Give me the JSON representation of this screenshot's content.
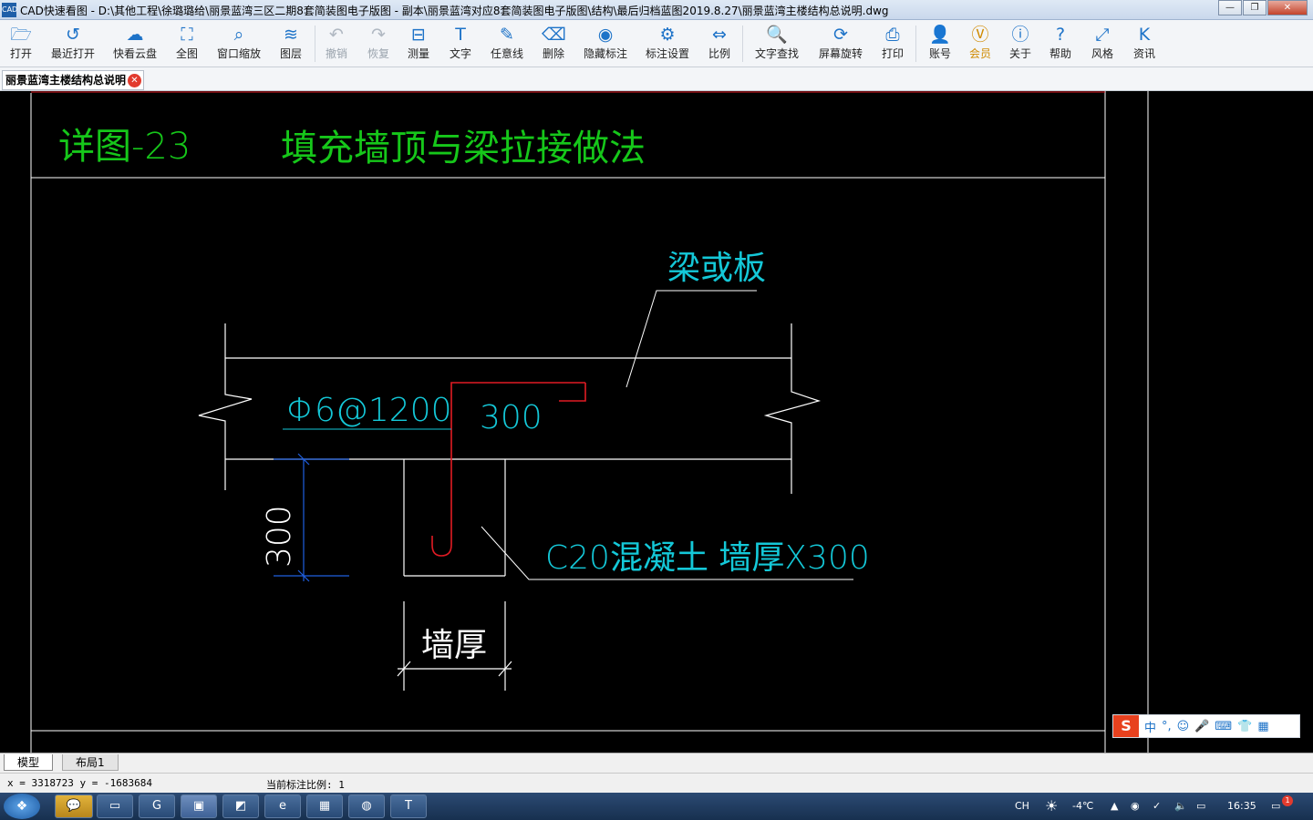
{
  "window": {
    "title": "CAD快速看图 - D:\\其他工程\\徐璐璐给\\丽景蓝湾三区二期8套简装图电子版图 - 副本\\丽景蓝湾对应8套简装图电子版图\\结构\\最后归档蓝图2019.8.27\\丽景蓝湾主楼结构总说明.dwg",
    "icon_text": "CAD"
  },
  "toolbar": [
    {
      "label": "打开",
      "icon": "folder-open-icon",
      "glyph": "🗁"
    },
    {
      "label": "最近打开",
      "icon": "recent-icon",
      "glyph": "↺"
    },
    {
      "label": "快看云盘",
      "icon": "cloud-icon",
      "glyph": "☁"
    },
    {
      "label": "全图",
      "icon": "fit-all-icon",
      "glyph": "⛶"
    },
    {
      "label": "窗口缩放",
      "icon": "zoom-window-icon",
      "glyph": "⌕"
    },
    {
      "label": "图层",
      "icon": "layers-icon",
      "glyph": "≋"
    },
    {
      "label": "撤销",
      "icon": "undo-icon",
      "glyph": "↶"
    },
    {
      "label": "恢复",
      "icon": "redo-icon",
      "glyph": "↷"
    },
    {
      "label": "测量",
      "icon": "measure-icon",
      "glyph": "⊟"
    },
    {
      "label": "文字",
      "icon": "text-icon",
      "glyph": "T"
    },
    {
      "label": "任意线",
      "icon": "pen-icon",
      "glyph": "✎"
    },
    {
      "label": "删除",
      "icon": "eraser-icon",
      "glyph": "⌫"
    },
    {
      "label": "隐藏标注",
      "icon": "hide-eye-icon",
      "glyph": "◉"
    },
    {
      "label": "标注设置",
      "icon": "annotation-settings-icon",
      "glyph": "⚙"
    },
    {
      "label": "比例",
      "icon": "scale-icon",
      "glyph": "⇔"
    },
    {
      "label": "文字查找",
      "icon": "text-search-icon",
      "glyph": "🔍"
    },
    {
      "label": "屏幕旋转",
      "icon": "rotate-screen-icon",
      "glyph": "⟳"
    },
    {
      "label": "打印",
      "icon": "printer-icon",
      "glyph": "⎙"
    },
    {
      "label": "账号",
      "icon": "user-icon",
      "glyph": "👤"
    },
    {
      "label": "会员",
      "icon": "vip-icon",
      "glyph": "Ⓥ"
    },
    {
      "label": "关于",
      "icon": "info-icon",
      "glyph": "ⓘ"
    },
    {
      "label": "帮助",
      "icon": "help-icon",
      "glyph": "?"
    },
    {
      "label": "风格",
      "icon": "style-icon",
      "glyph": "⤢"
    },
    {
      "label": "资讯",
      "icon": "news-icon",
      "glyph": "K"
    }
  ],
  "document_tab": {
    "label": "丽景蓝湾主楼结构总说明"
  },
  "drawing": {
    "detail_number": "详图-23",
    "detail_title": "填充墙顶与梁拉接做法",
    "label_beam": "梁或板",
    "label_rebar": "Φ6@1200",
    "label_rebar_len": "300",
    "label_concrete": "C20混凝土  墙厚X300",
    "label_height": "300",
    "label_wall_thickness": "墙厚"
  },
  "ime": {
    "logo": "S",
    "mode": "中",
    "items": [
      "°,",
      "☺",
      "🎤",
      "⌨",
      "👕",
      "▦"
    ]
  },
  "layout_tabs": {
    "model": "模型",
    "layout1": "布局1"
  },
  "status": {
    "coords": "x = 3318723  y = -1683684",
    "scale": "当前标注比例: 1"
  },
  "taskbar": {
    "lang": "CH",
    "weather": "-4℃",
    "time": "16:35",
    "notify_count": "1"
  },
  "colors": {
    "green": "#16c71a",
    "cyan": "#14c8d8",
    "red": "#e11b24",
    "blue": "#1f5fe0",
    "white": "#ffffff"
  }
}
